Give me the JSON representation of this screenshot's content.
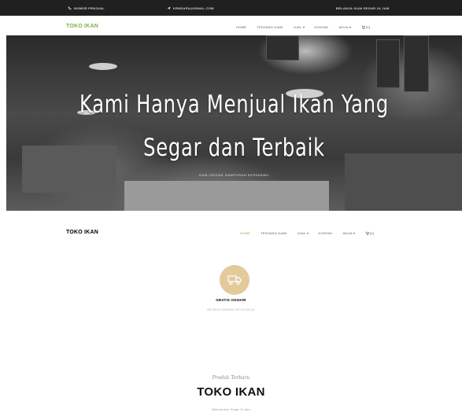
{
  "topbar": {
    "phone_label": "NOMOR PENJUAL",
    "email_label": "KENDAPA@GMAIL.COM",
    "promo_text": "BELANJA IKAN SEGAR 24 JAM",
    "phone_icon": "phone-icon",
    "email_icon": "paper-plane-icon"
  },
  "brand": "TOKO IKAN",
  "nav": {
    "items": [
      {
        "label": "HOME"
      },
      {
        "label": "TENTANG KAMI"
      },
      {
        "label": "JUAL"
      },
      {
        "label": "KONTAK"
      },
      {
        "label": "AKUN"
      }
    ],
    "cart_label": "[0]",
    "cart_icon": "cart-icon",
    "accent": "#82ae46"
  },
  "hero": {
    "title_line1": "Kami Hanya Menjual Ikan Yang",
    "title_line2": "Segar dan Terbaik",
    "subtitle": "KAMI SEGAR SAMPURAN KEPADAMU"
  },
  "service": {
    "icon": "truck-icon",
    "title": "GRATIS ONGKIR",
    "desc": "BELANJA MINIMAL RP 15.000,00",
    "circle_color": "#e4c99b"
  },
  "products": {
    "subheading": "Produk Terbaru",
    "title": "TOKO IKAN",
    "desc": "Bekerja Ikan Segar 24 Jam"
  }
}
